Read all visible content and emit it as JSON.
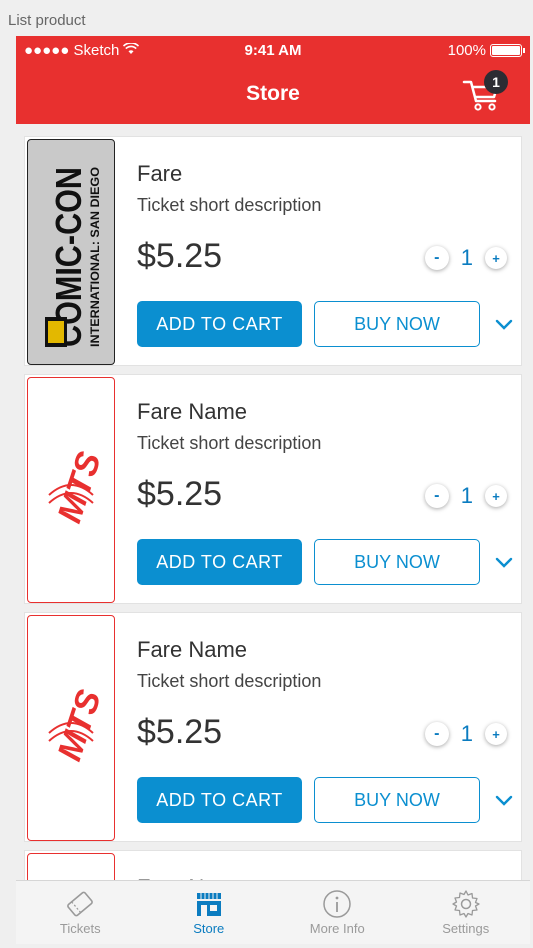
{
  "frame_label": "List product",
  "status": {
    "carrier": "●●●●● Sketch",
    "time": "9:41 AM",
    "battery": "100%",
    "battery_level": 1.0
  },
  "nav": {
    "title": "Store",
    "cart_count": "1"
  },
  "colors": {
    "accent": "#e8302f",
    "primary": "#0b8fd0",
    "tab_active": "#0b7cc0"
  },
  "products": [
    {
      "name": "Fare",
      "description": "Ticket short description",
      "price": "$5.25",
      "qty": "1",
      "logo": "comic-con-logo",
      "logo_text": "COMIC-CON",
      "logo_sub": "INTERNATIONAL: SAN DIEGO",
      "add_label": "ADD TO CART",
      "buy_label": "BUY NOW"
    },
    {
      "name": "Fare Name",
      "description": "Ticket short description",
      "price": "$5.25",
      "qty": "1",
      "logo": "mts-logo",
      "logo_text": "MTS",
      "add_label": "ADD TO CART",
      "buy_label": "BUY NOW"
    },
    {
      "name": "Fare Name",
      "description": "Ticket short description",
      "price": "$5.25",
      "qty": "1",
      "logo": "mts-logo",
      "logo_text": "MTS",
      "add_label": "ADD TO CART",
      "buy_label": "BUY NOW"
    },
    {
      "name": "Fare Name",
      "logo": "mts-logo"
    }
  ],
  "qty_controls": {
    "minus": "-",
    "plus": "+"
  },
  "tabs": [
    {
      "label": "Tickets",
      "icon": "ticket-icon",
      "active": false
    },
    {
      "label": "Store",
      "icon": "store-icon",
      "active": true
    },
    {
      "label": "More Info",
      "icon": "info-icon",
      "active": false
    },
    {
      "label": "Settings",
      "icon": "gear-icon",
      "active": false
    }
  ]
}
